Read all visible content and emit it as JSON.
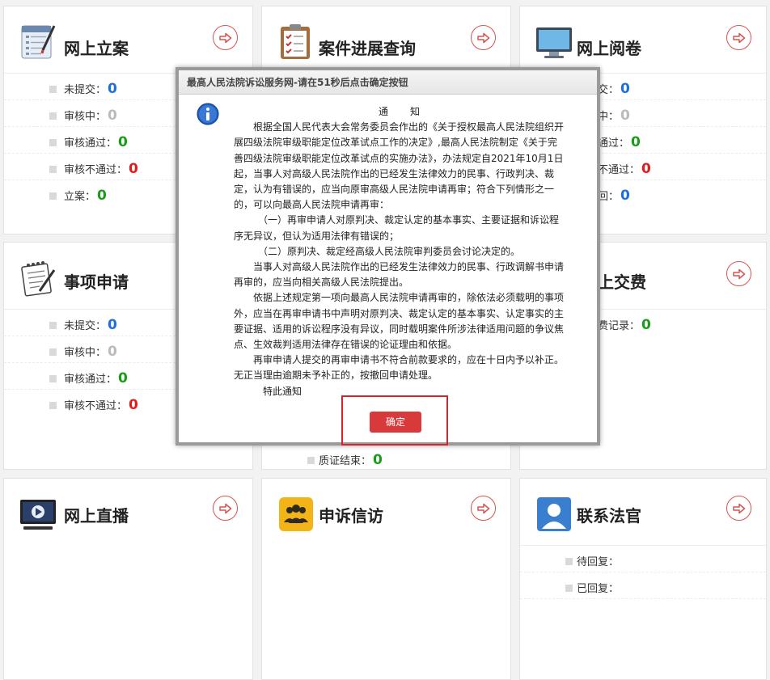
{
  "cards": [
    {
      "key": "wsla",
      "title": "网上立案",
      "icon": "checklist-icon",
      "rows": [
        {
          "label": "未提交：",
          "value": "0",
          "color": "blue"
        },
        {
          "label": "审核中：",
          "value": "0",
          "color": "gray"
        },
        {
          "label": "审核通过：",
          "value": "0",
          "color": "green"
        },
        {
          "label": "审核不通过：",
          "value": "0",
          "color": "red"
        },
        {
          "label": "立案：",
          "value": "0",
          "color": "green"
        }
      ]
    },
    {
      "key": "ajjzcx",
      "title": "案件进展查询",
      "icon": "clipboard-icon",
      "rows": []
    },
    {
      "key": "wsyj",
      "title": "网上阅卷",
      "icon": "monitor-icon",
      "rows": [
        {
          "label": "交：",
          "value": "0",
          "color": "blue"
        },
        {
          "label": "中：",
          "value": "0",
          "color": "gray"
        },
        {
          "label": "通过：",
          "value": "0",
          "color": "green"
        },
        {
          "label": "不通过：",
          "value": "0",
          "color": "red"
        },
        {
          "label": "回：",
          "value": "0",
          "color": "blue"
        }
      ]
    },
    {
      "key": "sxsq",
      "title": "事项申请",
      "icon": "notepad-icon",
      "rows": [
        {
          "label": "未提交：",
          "value": "0",
          "color": "blue"
        },
        {
          "label": "审核中：",
          "value": "0",
          "color": "gray"
        },
        {
          "label": "审核通过：",
          "value": "0",
          "color": "green"
        },
        {
          "label": "审核不通过：",
          "value": "0",
          "color": "red"
        }
      ]
    },
    {
      "key": "middle2",
      "title": "",
      "icon": "",
      "rows": [
        {
          "label": "质证结束：",
          "value": "0",
          "color": "green"
        }
      ]
    },
    {
      "key": "wsjf",
      "title": "上交费",
      "icon": "",
      "rows": [
        {
          "label": "费记录：",
          "value": "0",
          "color": "green"
        }
      ]
    },
    {
      "key": "wszb",
      "title": "网上直播",
      "icon": "video-icon",
      "rows": []
    },
    {
      "key": "ssxf",
      "title": "申诉信访",
      "icon": "people-icon",
      "rows": []
    },
    {
      "key": "lxfg",
      "title": "联系法官",
      "icon": "contact-icon",
      "rows": [
        {
          "label": "待回复：",
          "value": "",
          "color": "blue"
        },
        {
          "label": "已回复：",
          "value": "",
          "color": "blue"
        }
      ]
    }
  ],
  "modal": {
    "title": "最高人民法院诉讼服务网-请在51秒后点击确定按钮",
    "heading": "通　　知",
    "paragraphs": [
      "根据全国人民代表大会常务委员会作出的《关于授权最高人民法院组织开展四级法院审级职能定位改革试点工作的决定》,最高人民法院制定《关于完善四级法院审级职能定位改革试点的实施办法》，办法规定自2021年10月1日起，当事人对高级人民法院作出的已经发生法律效力的民事、行政判决、裁定，认为有错误的，应当向原审高级人民法院申请再审；符合下列情形之一的，可以向最高人民法院申请再审：",
      "（一）再审申请人对原判决、裁定认定的基本事实、主要证据和诉讼程序无异议，但认为适用法律有错误的；",
      "（二）原判决、裁定经高级人民法院审判委员会讨论决定的。",
      "当事人对高级人民法院作出的已经发生法律效力的民事、行政调解书申请再审的，应当向相关高级人民法院提出。",
      "依据上述规定第一项向最高人民法院申请再审的，除依法必须载明的事项外，应当在再审申请书中声明对原判决、裁定认定的基本事实、认定事实的主要证据、适用的诉讼程序没有异议，同时载明案件所涉法律适用问题的争议焦点、生效裁判适用法律存在错误的论证理由和依据。",
      "再审申请人提交的再审申请书不符合前款要求的，应在十日内予以补正。无正当理由逾期未予补正的，按撤回申请处理。"
    ],
    "sign": "特此通知",
    "confirm_label": "确定"
  },
  "colors": {
    "accent": "#d8393b",
    "blue": "#1e6fd9",
    "green": "#1a9c1a",
    "red": "#d9201f",
    "gray": "#bbbbbb"
  }
}
